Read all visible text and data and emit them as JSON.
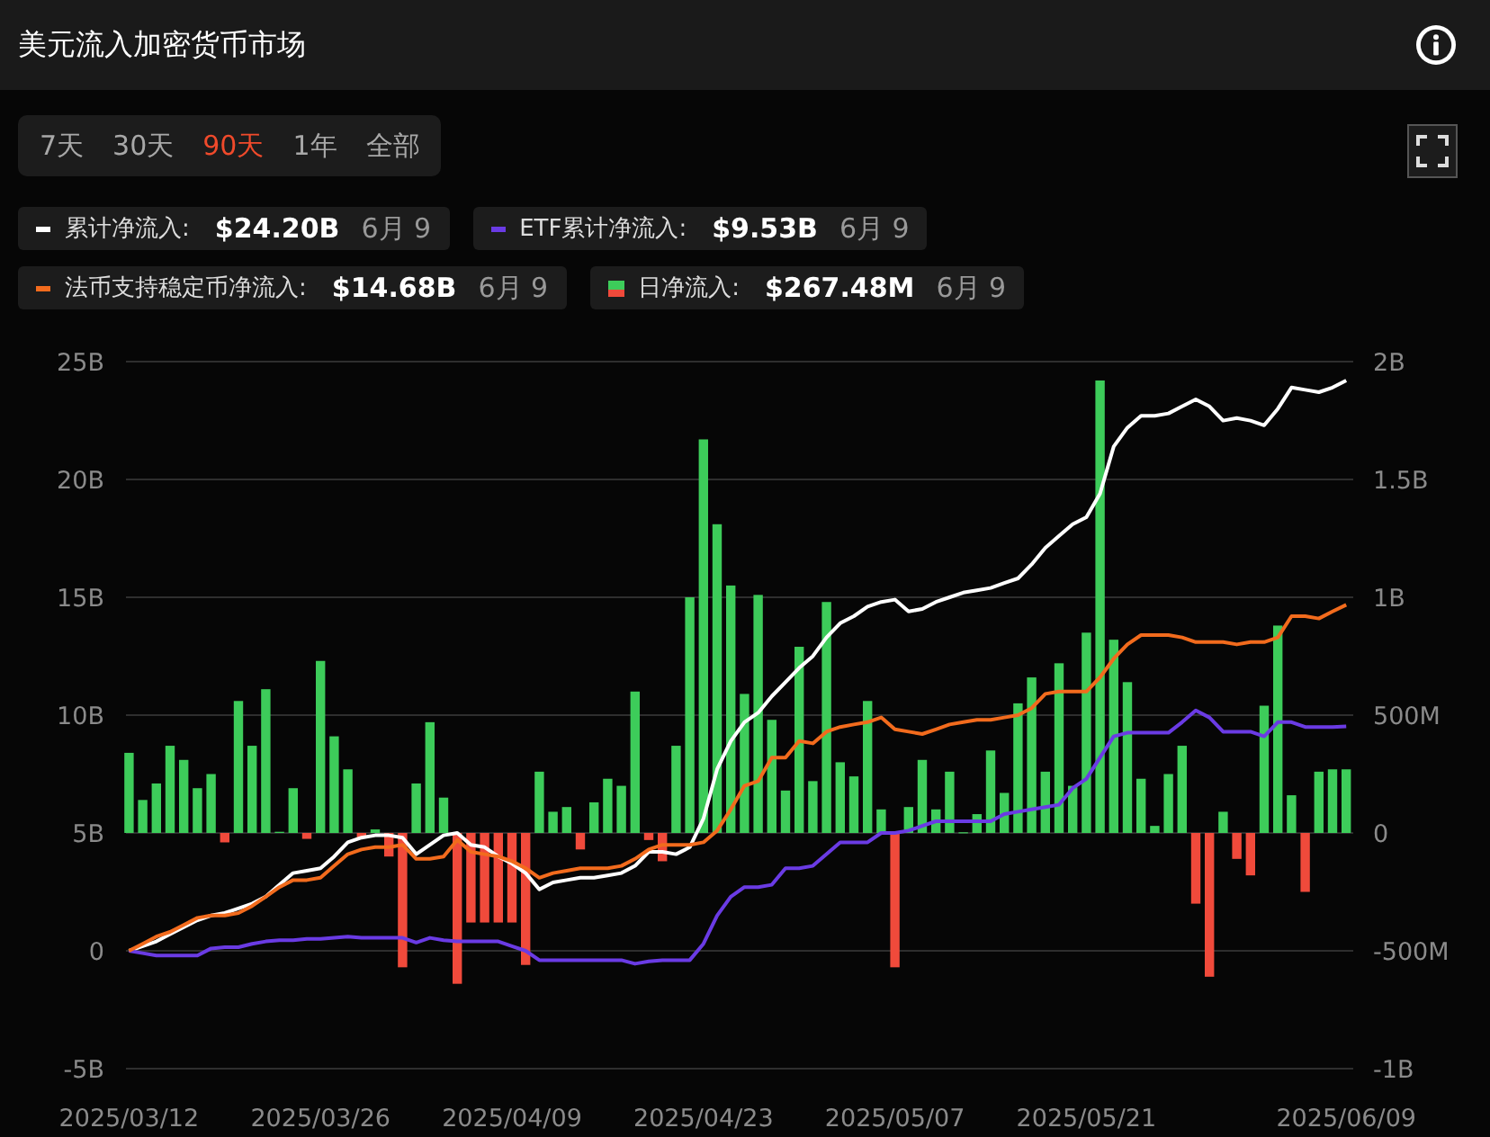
{
  "header": {
    "title": "美元流入加密货币市场"
  },
  "range_tabs": [
    {
      "label": "7天",
      "selected": false
    },
    {
      "label": "30天",
      "selected": false
    },
    {
      "label": "90天",
      "selected": true
    },
    {
      "label": "1年",
      "selected": false
    },
    {
      "label": "全部",
      "selected": false
    }
  ],
  "legend": [
    {
      "kind": "line",
      "color": "#ffffff",
      "label": "累计净流入:",
      "value": "$24.20B",
      "date": "6月 9"
    },
    {
      "kind": "line",
      "color": "#6a3be4",
      "label": "ETF累计净流入:",
      "value": "$9.53B",
      "date": "6月 9"
    },
    {
      "kind": "line",
      "color": "#f26b1d",
      "label": "法币支持稳定币净流入:",
      "value": "$14.68B",
      "date": "6月 9"
    },
    {
      "kind": "bar",
      "color": "#3dcc5a",
      "label": "日净流入:",
      "value": "$267.48M",
      "date": "6月 9"
    }
  ],
  "chart": {
    "chart_data": {
      "type": "line",
      "grid": true,
      "categories": [
        "2025/03/12",
        null,
        null,
        null,
        null,
        null,
        null,
        null,
        null,
        null,
        null,
        null,
        null,
        null,
        "2025/03/26",
        null,
        null,
        null,
        null,
        null,
        null,
        null,
        null,
        null,
        null,
        null,
        null,
        null,
        "2025/04/09",
        null,
        null,
        null,
        null,
        null,
        null,
        null,
        null,
        null,
        null,
        null,
        null,
        null,
        "2025/04/23",
        null,
        null,
        null,
        null,
        null,
        null,
        null,
        null,
        null,
        null,
        null,
        null,
        null,
        "2025/05/07",
        null,
        null,
        null,
        null,
        null,
        null,
        null,
        null,
        null,
        null,
        null,
        null,
        null,
        "2025/05/21",
        null,
        null,
        null,
        null,
        null,
        null,
        null,
        null,
        null,
        null,
        null,
        null,
        null,
        null,
        null,
        null,
        null,
        null,
        "2025/06/09"
      ],
      "series": [
        {
          "type": "bar",
          "axis": "y2",
          "color": "#3dcc5a",
          "values": [
            340000000.0,
            140000000.0,
            210000000.0,
            370000000.0,
            310000000.0,
            190000000.0,
            250000000.0,
            null,
            560000000.0,
            370000000.0,
            610000000.0,
            5000000.0,
            190000000.0,
            null,
            730000000.0,
            410000000.0,
            270000000.0,
            null,
            15000000.0,
            null,
            null,
            210000000.0,
            470000000.0,
            150000000.0,
            null,
            null,
            null,
            null,
            null,
            null,
            260000000.0,
            90000000.0,
            110000000.0,
            null,
            130000000.0,
            230000000.0,
            200000000.0,
            600000000.0,
            null,
            null,
            370000000.0,
            1000000000.0,
            1670000000.0,
            1310000000.0,
            1050000000.0,
            590000000.0,
            1010000000.0,
            480000000.0,
            180000000.0,
            790000000.0,
            220000000.0,
            980000000.0,
            300000000.0,
            240000000.0,
            560000000.0,
            100000000.0,
            null,
            110000000.0,
            310000000.0,
            100000000.0,
            260000000.0,
            3000000.0,
            80000000.0,
            350000000.0,
            170000000.0,
            550000000.0,
            660000000.0,
            260000000.0,
            720000000.0,
            200000000.0,
            850000000.0,
            1920000000.0,
            820000000.0,
            640000000.0,
            230000000.0,
            30000000.0,
            250000000.0,
            370000000.0,
            null,
            null,
            90000000.0,
            null,
            null,
            540000000.0,
            880000000.0,
            160000000.0,
            null,
            260000000.0,
            270000000.0,
            270000000.0
          ]
        },
        {
          "type": "bar",
          "axis": "y2",
          "color": "#f04a3b",
          "values": [
            null,
            null,
            null,
            null,
            null,
            null,
            null,
            -40000000.0,
            null,
            null,
            null,
            null,
            null,
            -25000000.0,
            null,
            null,
            null,
            -20000000.0,
            null,
            -100000000.0,
            -570000000.0,
            null,
            null,
            null,
            -640000000.0,
            -380000000.0,
            -380000000.0,
            -380000000.0,
            -380000000.0,
            -560000000.0,
            null,
            null,
            null,
            -70000000.0,
            null,
            null,
            null,
            null,
            -30000000.0,
            -120000000.0,
            null,
            null,
            null,
            null,
            null,
            null,
            null,
            null,
            null,
            null,
            null,
            null,
            null,
            null,
            null,
            null,
            -570000000.0,
            null,
            null,
            null,
            null,
            null,
            null,
            null,
            null,
            null,
            null,
            null,
            null,
            null,
            null,
            null,
            null,
            null,
            null,
            null,
            null,
            null,
            -300000000.0,
            -610000000.0,
            null,
            -110000000.0,
            -180000000.0,
            null,
            null,
            null,
            -250000000.0,
            null,
            null,
            null
          ]
        },
        {
          "type": "line",
          "axis": "y",
          "color": "#ffffff",
          "values": [
            0,
            0.2,
            0.4,
            0.7,
            1.0,
            1.3,
            1.5,
            1.6,
            1.8,
            2.0,
            2.3,
            2.8,
            3.3,
            3.4,
            3.5,
            4.0,
            4.6,
            4.8,
            4.9,
            4.9,
            4.8,
            4.1,
            4.5,
            4.9,
            5.0,
            4.5,
            4.4,
            4.0,
            3.7,
            3.3,
            2.6,
            2.9,
            3.0,
            3.1,
            3.1,
            3.2,
            3.3,
            3.6,
            4.2,
            4.2,
            4.1,
            4.4,
            5.6,
            7.7,
            8.9,
            9.7,
            10.1,
            10.8,
            11.4,
            12.0,
            12.5,
            13.3,
            13.9,
            14.2,
            14.6,
            14.8,
            14.9,
            14.4,
            14.5,
            14.8,
            15.0,
            15.2,
            15.3,
            15.4,
            15.6,
            15.8,
            16.4,
            17.1,
            17.6,
            18.1,
            18.4,
            19.4,
            21.4,
            22.2,
            22.7,
            22.7,
            22.8,
            23.1,
            23.4,
            23.1,
            22.5,
            22.6,
            22.5,
            22.3,
            23.0,
            23.9,
            23.8,
            23.7,
            23.9,
            24.2
          ]
        },
        {
          "type": "line",
          "axis": "y",
          "color": "#6a3be4",
          "values": [
            0,
            -0.1,
            -0.2,
            -0.2,
            -0.2,
            -0.2,
            0.1,
            0.15,
            0.15,
            0.3,
            0.4,
            0.45,
            0.45,
            0.5,
            0.5,
            0.55,
            0.6,
            0.55,
            0.55,
            0.55,
            0.55,
            0.35,
            0.55,
            0.45,
            0.4,
            0.4,
            0.4,
            0.4,
            0.2,
            0.0,
            -0.4,
            -0.4,
            -0.4,
            -0.4,
            -0.4,
            -0.4,
            -0.4,
            -0.55,
            -0.45,
            -0.4,
            -0.4,
            -0.4,
            0.3,
            1.5,
            2.3,
            2.7,
            2.7,
            2.8,
            3.5,
            3.5,
            3.6,
            4.1,
            4.6,
            4.6,
            4.6,
            5.0,
            5.0,
            5.1,
            5.3,
            5.5,
            5.5,
            5.5,
            5.5,
            5.5,
            5.8,
            5.9,
            6.0,
            6.1,
            6.2,
            6.9,
            7.3,
            8.2,
            9.1,
            9.25,
            9.25,
            9.25,
            9.25,
            9.7,
            10.2,
            9.9,
            9.3,
            9.3,
            9.3,
            9.1,
            9.7,
            9.7,
            9.5,
            9.5,
            9.5,
            9.53
          ]
        },
        {
          "type": "line",
          "axis": "y",
          "color": "#f26b1d",
          "values": [
            0,
            0.3,
            0.6,
            0.8,
            1.1,
            1.4,
            1.5,
            1.5,
            1.6,
            1.9,
            2.3,
            2.7,
            3.0,
            3.0,
            3.1,
            3.6,
            4.1,
            4.3,
            4.4,
            4.4,
            4.5,
            3.9,
            3.9,
            4.0,
            4.7,
            4.2,
            4.1,
            4.0,
            3.8,
            3.5,
            3.1,
            3.3,
            3.4,
            3.5,
            3.5,
            3.5,
            3.6,
            3.9,
            4.3,
            4.5,
            4.5,
            4.5,
            4.6,
            5.1,
            6.0,
            7.0,
            7.2,
            8.2,
            8.2,
            8.9,
            8.8,
            9.3,
            9.5,
            9.6,
            9.7,
            9.9,
            9.4,
            9.3,
            9.2,
            9.4,
            9.6,
            9.7,
            9.8,
            9.8,
            9.9,
            10.0,
            10.3,
            10.9,
            11.0,
            11.0,
            11.0,
            11.6,
            12.4,
            13.0,
            13.4,
            13.4,
            13.4,
            13.3,
            13.1,
            13.1,
            13.1,
            13.0,
            13.1,
            13.1,
            13.3,
            14.2,
            14.2,
            14.1,
            14.4,
            14.68
          ]
        }
      ],
      "ylim": [
        -5,
        25
      ],
      "yticks": [
        {
          "value": -5,
          "label": "-5B"
        },
        {
          "value": 0,
          "label": "0"
        },
        {
          "value": 5,
          "label": "5B"
        },
        {
          "value": 10,
          "label": "10B"
        },
        {
          "value": 15,
          "label": "15B"
        },
        {
          "value": 20,
          "label": "20B"
        },
        {
          "value": 25,
          "label": "25B"
        }
      ],
      "y2lim": [
        -1000000000.0,
        2000000000.0
      ],
      "y2ticks": [
        {
          "value": -1000000000.0,
          "label": "-1B"
        },
        {
          "value": -500000000.0,
          "label": "-500M"
        },
        {
          "value": 0,
          "label": "0"
        },
        {
          "value": 500000000.0,
          "label": "500M"
        },
        {
          "value": 1000000000.0,
          "label": "1B"
        },
        {
          "value": 1500000000.0,
          "label": "1.5B"
        },
        {
          "value": 2000000000.0,
          "label": "2B"
        }
      ]
    }
  }
}
